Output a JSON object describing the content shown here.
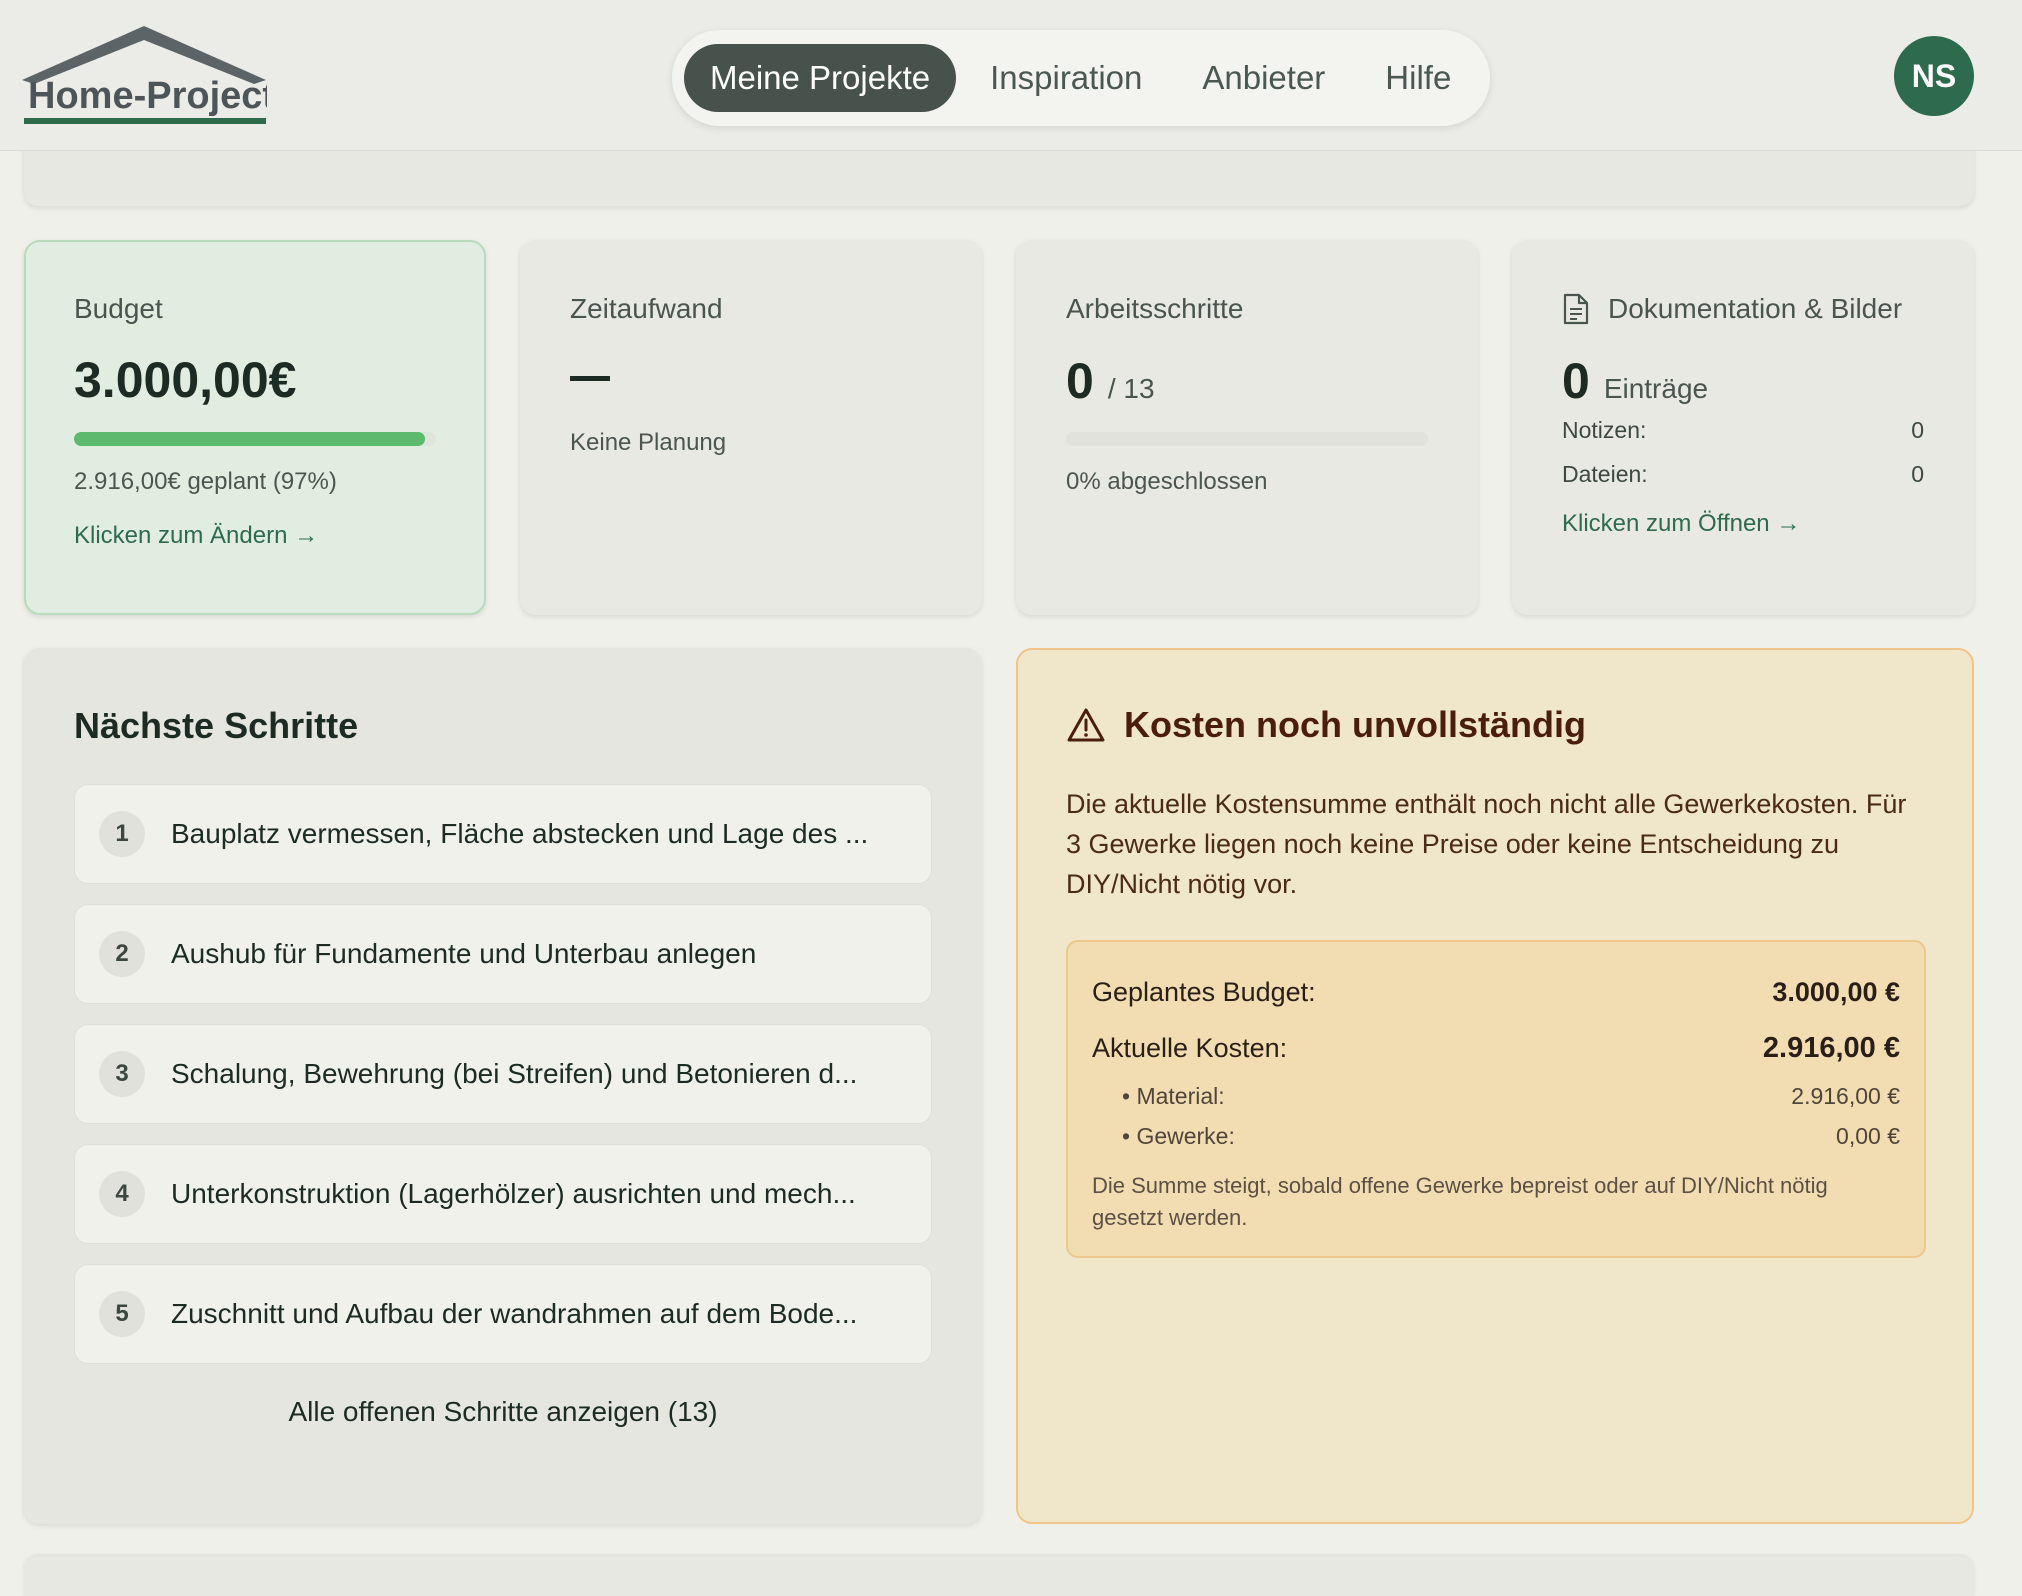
{
  "brand": {
    "logo_text": "Home-Projects"
  },
  "nav": {
    "items": [
      {
        "label": "Meine Projekte",
        "active": true
      },
      {
        "label": "Inspiration",
        "active": false
      },
      {
        "label": "Anbieter",
        "active": false
      },
      {
        "label": "Hilfe",
        "active": false
      }
    ]
  },
  "user": {
    "initials": "NS"
  },
  "budget": {
    "label": "Budget",
    "value": "3.000,00€",
    "progress_fraction": 0.97,
    "planned_text": "2.916,00€ geplant (97%)",
    "link": "Klicken zum Ändern →"
  },
  "time": {
    "label": "Zeitaufwand",
    "value": "—",
    "sub": "Keine Planung"
  },
  "steps_stat": {
    "label": "Arbeitsschritte",
    "done": "0",
    "total": "/ 13",
    "progress_fraction": 0,
    "sub": "0% abgeschlossen"
  },
  "docs": {
    "label": "Dokumentation & Bilder",
    "count": "0",
    "count_label": "Einträge",
    "notes_label": "Notizen:",
    "notes_value": "0",
    "files_label": "Dateien:",
    "files_value": "0",
    "link": "Klicken zum Öffnen →",
    "icon": "document-icon"
  },
  "next_steps": {
    "title": "Nächste Schritte",
    "items": [
      {
        "num": "1",
        "text": "Bauplatz vermessen, Fläche abstecken und Lage des ..."
      },
      {
        "num": "2",
        "text": "Aushub für Fundamente und Unterbau anlegen"
      },
      {
        "num": "3",
        "text": "Schalung, Bewehrung (bei Streifen) und Betonieren d..."
      },
      {
        "num": "4",
        "text": "Unterkonstruktion (Lagerhölzer) ausrichten und mech..."
      },
      {
        "num": "5",
        "text": "Zuschnitt und Aufbau der wandrahmen auf dem Bode..."
      }
    ],
    "show_all": "Alle offenen Schritte anzeigen (13)"
  },
  "warning": {
    "icon": "warning-icon",
    "title": "Kosten noch unvollständig",
    "text": "Die aktuelle Kostensumme enthält noch nicht alle Gewerkekosten. Für 3 Gewerke liegen noch keine Preise oder keine Entscheidung zu DIY/Nicht nötig vor.",
    "planned_label": "Geplantes Budget:",
    "planned_value": "3.000,00 €",
    "current_label": "Aktuelle Kosten:",
    "current_value": "2.916,00 €",
    "material_label": "• Material:",
    "material_value": "2.916,00 €",
    "trades_label": "• Gewerke:",
    "trades_value": "0,00 €",
    "note": "Die Summe steigt, sobald offene Gewerke bepreist oder auf DIY/Nicht nötig gesetzt werden."
  },
  "colors": {
    "accent_green": "#2e6b4c",
    "progress_green": "#5cba6c",
    "warning_bg": "#f0e6c9",
    "warning_border": "#f0c48a"
  }
}
